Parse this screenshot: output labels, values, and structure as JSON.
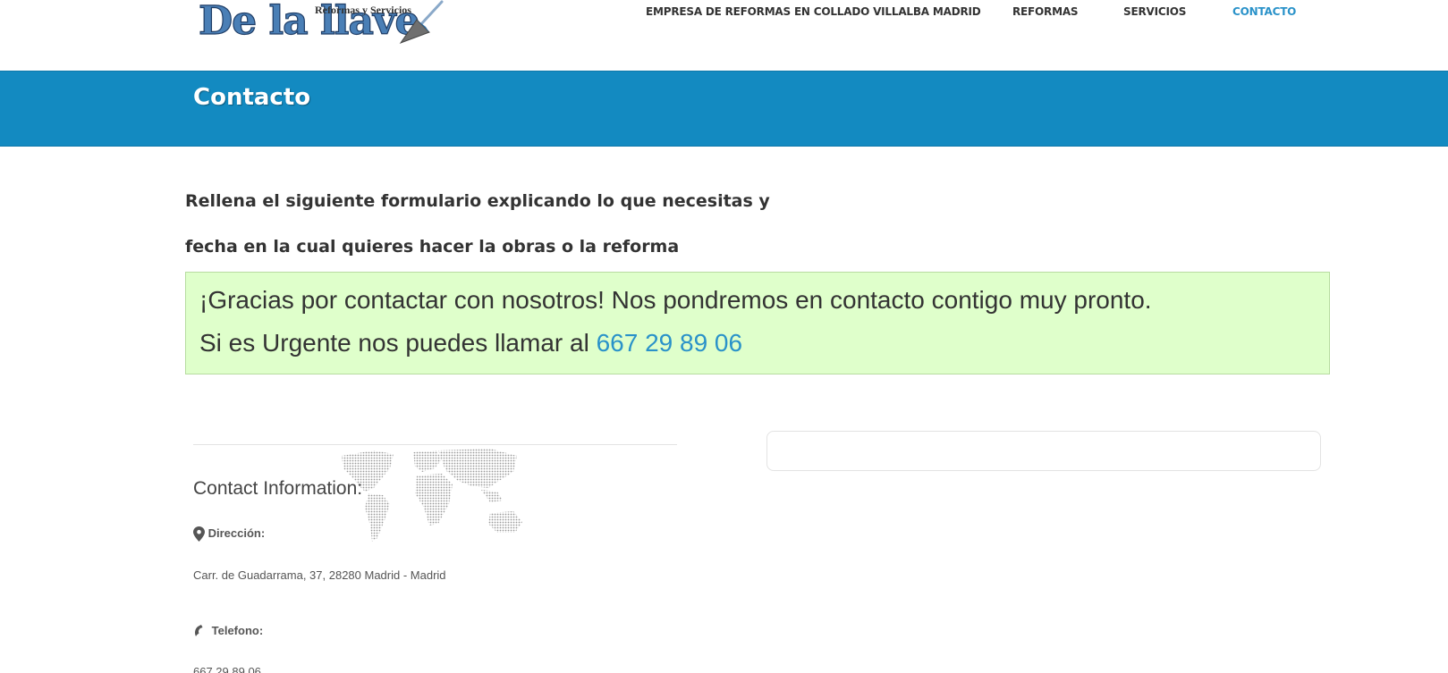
{
  "logo": {
    "main": "De la llave",
    "sub": "Reformas y Servicios"
  },
  "nav": {
    "items": [
      {
        "label": "EMPRESA DE REFORMAS EN COLLADO VILLALBA MADRID"
      },
      {
        "label": "REFORMAS"
      },
      {
        "label": "SERVICIOS"
      },
      {
        "label": "CONTACTO"
      }
    ],
    "active_index": 3
  },
  "banner": {
    "title": "Contacto"
  },
  "intro": {
    "line1": "Rellena el siguiente formulario explicando lo que necesitas y",
    "line2": "fecha en la cual quieres hacer la obras o la reforma"
  },
  "success": {
    "line1": "¡Gracias por contactar con nosotros! Nos pondremos en contacto contigo muy pronto.",
    "line2_prefix": "Si es Urgente nos puedes llamar al ",
    "phone": "667 29 89 06"
  },
  "contact": {
    "title": "Contact Information:",
    "address_label": "Dirección:",
    "address_value": "Carr. de Guadarrama, 37, 28280 Madrid - Madrid",
    "phone_label": "Telefono:",
    "phone_value": "667 29 89 06"
  },
  "colors": {
    "accent": "#2a92c9",
    "banner": "#138ac1",
    "success_bg": "#dfffcb"
  }
}
